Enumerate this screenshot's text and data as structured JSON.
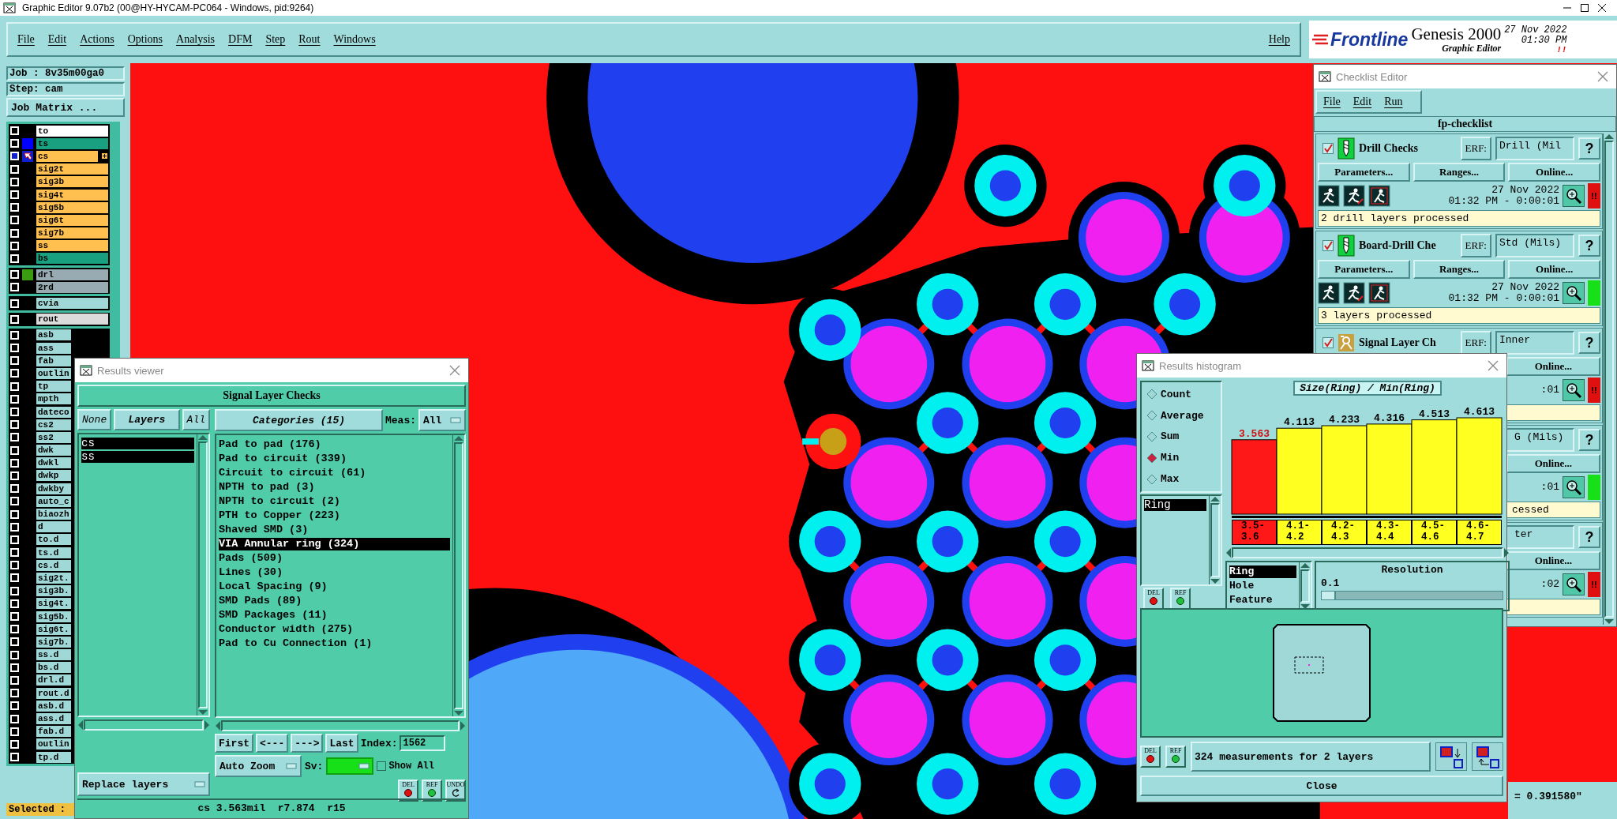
{
  "window": {
    "title": "Graphic Editor 9.07b2 (00@HY-HYCAM-PC064 - Windows, pid:9264)"
  },
  "menu": [
    "File",
    "Edit",
    "Actions",
    "Options",
    "Analysis",
    "DFM",
    "Step",
    "Rout",
    "Windows"
  ],
  "help": "Help",
  "logo": {
    "brand": "Frontline",
    "product": "Genesis 2000",
    "subtitle": "Graphic Editor",
    "date": "27 Nov 2022",
    "time": "01:30 PM",
    "alert": "!!"
  },
  "job_panel": {
    "job": "Job : 8v35m00ga0",
    "step": "Step: cam",
    "matrix_button": "Job Matrix ...",
    "layer_groups": [
      {
        "layers": [
          {
            "name": "to",
            "color": "#ffffff",
            "selected": false
          },
          {
            "name": "ts",
            "color": "#18a080",
            "selected": false,
            "swatch": {
              "color": "#0000ff"
            }
          },
          {
            "name": "cs",
            "color": "#ffc050",
            "selected": true
          },
          {
            "name": "sig2t",
            "color": "#ffc050",
            "selected": false
          },
          {
            "name": "sig3b",
            "color": "#ffc050",
            "selected": false
          },
          {
            "name": "sig4t",
            "color": "#ffc050",
            "selected": false
          },
          {
            "name": "sig5b",
            "color": "#ffc050",
            "selected": false
          },
          {
            "name": "sig6t",
            "color": "#ffc050",
            "selected": false
          },
          {
            "name": "sig7b",
            "color": "#ffc050",
            "selected": false
          },
          {
            "name": "ss",
            "color": "#ffc050",
            "selected": false
          },
          {
            "name": "bs",
            "color": "#18a080",
            "selected": false
          }
        ]
      },
      {
        "layers": [
          {
            "name": "drl",
            "color": "#98aab2",
            "selected": false,
            "swatch": {
              "color": "#3a9a10"
            }
          },
          {
            "name": "2rd",
            "color": "#98aab2",
            "selected": false
          }
        ]
      },
      {
        "layers": [
          {
            "name": "cvia",
            "color": "#a0d8d8",
            "selected": false
          }
        ]
      },
      {
        "layers": [
          {
            "name": "rout",
            "color": "#dcdcdc",
            "selected": false
          }
        ]
      },
      {
        "layers": [
          {
            "name": "asb",
            "color": "#a0d8d8",
            "selected": false
          },
          {
            "name": "ass",
            "color": "#a0d8d8",
            "selected": false
          },
          {
            "name": "fab",
            "color": "#a0d8d8",
            "selected": false
          },
          {
            "name": "outlin",
            "color": "#a0d8d8",
            "selected": false
          },
          {
            "name": "tp",
            "color": "#a0d8d8",
            "selected": false
          },
          {
            "name": "mpth",
            "color": "#a0d8d8",
            "selected": false
          },
          {
            "name": "dateco",
            "color": "#a0d8d8",
            "selected": false
          },
          {
            "name": "cs2",
            "color": "#a0d8d8",
            "selected": false
          },
          {
            "name": "ss2",
            "color": "#a0d8d8",
            "selected": false
          },
          {
            "name": "dwk",
            "color": "#a0d8d8",
            "selected": false
          },
          {
            "name": "dwkl",
            "color": "#a0d8d8",
            "selected": false
          },
          {
            "name": "dwkp",
            "color": "#a0d8d8",
            "selected": false
          },
          {
            "name": "dwkby",
            "color": "#a0d8d8",
            "selected": false
          },
          {
            "name": "auto_c",
            "color": "#a0d8d8",
            "selected": false
          },
          {
            "name": "biaozh",
            "color": "#a0d8d8",
            "selected": false
          },
          {
            "name": "d",
            "color": "#a0d8d8",
            "selected": false
          },
          {
            "name": "to.d",
            "color": "#a0d8d8",
            "selected": false
          },
          {
            "name": "ts.d",
            "color": "#a0d8d8",
            "selected": false
          },
          {
            "name": "cs.d",
            "color": "#a0d8d8",
            "selected": false
          },
          {
            "name": "sig2t.",
            "color": "#a0d8d8",
            "selected": false
          },
          {
            "name": "sig3b.",
            "color": "#a0d8d8",
            "selected": false
          },
          {
            "name": "sig4t.",
            "color": "#a0d8d8",
            "selected": false
          },
          {
            "name": "sig5b.",
            "color": "#a0d8d8",
            "selected": false
          },
          {
            "name": "sig6t.",
            "color": "#a0d8d8",
            "selected": false
          },
          {
            "name": "sig7b.",
            "color": "#a0d8d8",
            "selected": false
          },
          {
            "name": "ss.d",
            "color": "#a0d8d8",
            "selected": false
          },
          {
            "name": "bs.d",
            "color": "#a0d8d8",
            "selected": false
          },
          {
            "name": "drl.d",
            "color": "#a0d8d8",
            "selected": false
          },
          {
            "name": "rout.d",
            "color": "#a0d8d8",
            "selected": false
          },
          {
            "name": "asb.d",
            "color": "#a0d8d8",
            "selected": false
          },
          {
            "name": "ass.d",
            "color": "#a0d8d8",
            "selected": false
          },
          {
            "name": "fab.d",
            "color": "#a0d8d8",
            "selected": false
          },
          {
            "name": "outlin",
            "color": "#a0d8d8",
            "selected": false
          },
          {
            "name": "tp.d",
            "color": "#a0d8d8",
            "selected": false
          }
        ]
      }
    ],
    "selected_label": "Selected :"
  },
  "results_viewer": {
    "title": "Results viewer",
    "heading": "Signal Layer Checks",
    "layer_buttons": [
      "None",
      "Layers",
      "All"
    ],
    "layers": [
      {
        "name": "cs",
        "selected": true
      },
      {
        "name": "ss",
        "selected": true
      }
    ],
    "categories_header": "Categories (15)",
    "meas_label": "Meas:",
    "meas_value": "All",
    "categories": [
      {
        "label": "Pad to pad (176)",
        "selected": false
      },
      {
        "label": "Pad to circuit (339)",
        "selected": false
      },
      {
        "label": "Circuit to circuit (61)",
        "selected": false
      },
      {
        "label": "NPTH to pad (3)",
        "selected": false
      },
      {
        "label": "NPTH to circuit (2)",
        "selected": false
      },
      {
        "label": "PTH to Copper (223)",
        "selected": false
      },
      {
        "label": "Shaved SMD (3)",
        "selected": false
      },
      {
        "label": "VIA Annular ring (324)",
        "selected": true
      },
      {
        "label": "Pads (509)",
        "selected": false
      },
      {
        "label": "Lines (30)",
        "selected": false
      },
      {
        "label": "Local Spacing (9)",
        "selected": false
      },
      {
        "label": "SMD Pads (89)",
        "selected": false
      },
      {
        "label": "SMD Packages (11)",
        "selected": false
      },
      {
        "label": "Conductor width (275)",
        "selected": false
      },
      {
        "label": "Pad to Cu Connection (1)",
        "selected": false
      }
    ],
    "nav_buttons": [
      "First",
      "<---",
      "--->",
      "Last"
    ],
    "index_label": "Index:",
    "index_value": "1562",
    "zoom_mode": "Auto Zoom",
    "sv_label": "Sv:",
    "show_all": {
      "label": "Show All",
      "checked": false
    },
    "replace_mode": "Replace layers",
    "action_buttons": [
      "DEL",
      "REF",
      "UNDO"
    ],
    "status": "cs 3.563mil  r7.874  r15"
  },
  "checklist": {
    "title": "Checklist Editor",
    "menu": [
      "File",
      "Edit",
      "Run"
    ],
    "name": "fp-checklist",
    "checks": [
      {
        "kind": "drill",
        "checked": true,
        "name": "Drill Checks",
        "erf_label": "ERF:",
        "erf": "Drill (Mil",
        "help": "?",
        "buttons": [
          "Parameters...",
          "Ranges...",
          "Online..."
        ],
        "date": "27 Nov 2022",
        "time": "01:32 PM - 0:00:01",
        "passed": false,
        "mark": "!!",
        "message": "2 drill layers processed"
      },
      {
        "kind": "drill",
        "checked": true,
        "name": "Board-Drill Che",
        "erf_label": "ERF:",
        "erf": "Std (Mils)",
        "help": "?",
        "buttons": [
          "Parameters...",
          "Ranges...",
          "Online..."
        ],
        "date": "27 Nov 2022",
        "time": "01:32 PM - 0:00:01",
        "passed": true,
        "message": "3 layers processed"
      },
      {
        "kind": "signal",
        "checked": true,
        "name": "Signal Layer Ch",
        "erf_label": "ERF:",
        "erf": "Inner",
        "help": "?",
        "buttons": [
          "Online..."
        ],
        "time": ":01",
        "passed": false,
        "mark": "!!"
      },
      {
        "kind": "hidden",
        "erf": "G (Mils)",
        "help": "?",
        "buttons": [
          "Online..."
        ],
        "time": ":01",
        "passed": true,
        "message": "cessed"
      },
      {
        "kind": "hidden",
        "erf": "ter",
        "help": "?",
        "buttons": [
          "Online..."
        ],
        "time": ":02",
        "passed": false,
        "mark": "!!"
      }
    ]
  },
  "histogram": {
    "title": "Results histogram",
    "modes": [
      {
        "label": "Count",
        "selected": false
      },
      {
        "label": "Average",
        "selected": false
      },
      {
        "label": "Sum",
        "selected": false
      },
      {
        "label": "Min",
        "selected": true
      },
      {
        "label": "Max",
        "selected": false
      }
    ],
    "measures": [
      {
        "label": "Ring",
        "selected": true
      }
    ],
    "side_buttons": [
      "DEL",
      "REF"
    ],
    "chart_data": {
      "type": "bar",
      "title": "Size(Ring) / Min(Ring)",
      "categories": [
        "3.5-3.6",
        "4.1-4.2",
        "4.2-4.3",
        "4.3-4.4",
        "4.5-4.6",
        "4.6-4.7"
      ],
      "values": [
        3.563,
        4.113,
        4.233,
        4.316,
        4.513,
        4.613
      ],
      "data_labels": true
    },
    "fields": [
      {
        "label": "Ring",
        "selected": true
      },
      {
        "label": "Hole",
        "selected": false
      },
      {
        "label": "Feature",
        "selected": false
      }
    ],
    "resolution": {
      "label": "Resolution",
      "value": "0.1",
      "level": 0.08
    },
    "footer_buttons": [
      "DEL",
      "REF"
    ],
    "status": "324 measurements for 2 layers",
    "close": "Close"
  },
  "readout": "= 0.391580\""
}
